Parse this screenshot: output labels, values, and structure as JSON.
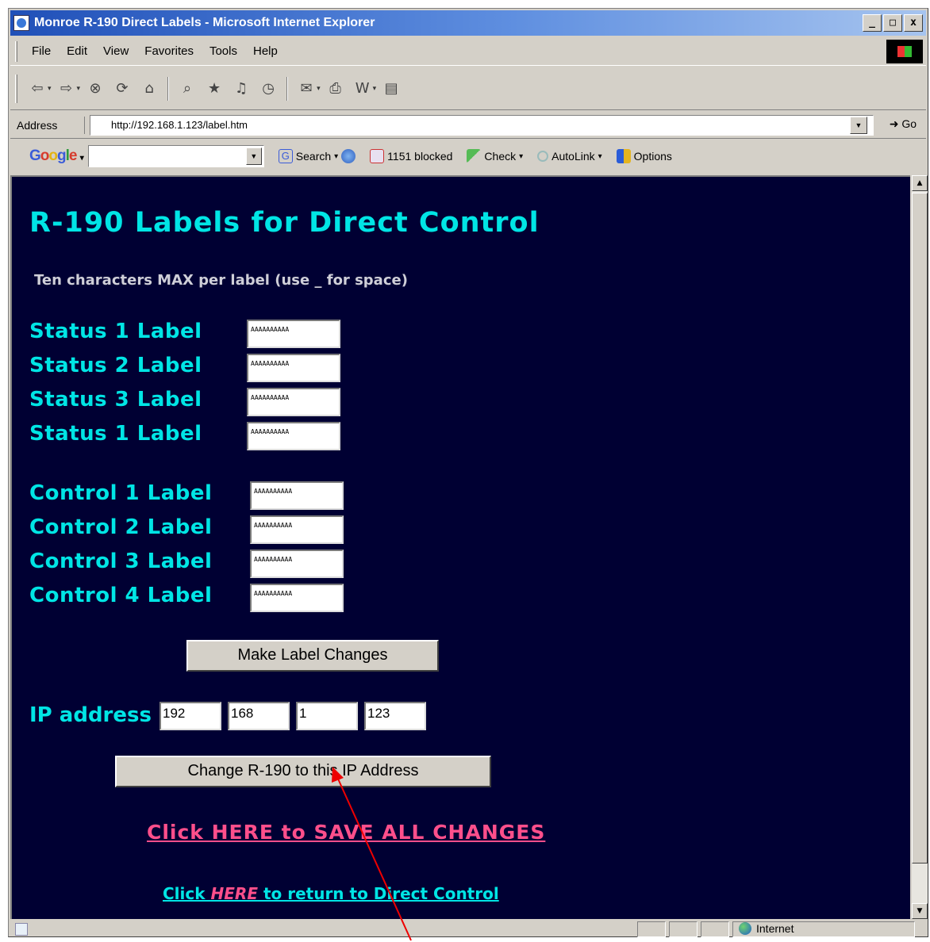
{
  "window": {
    "title": "Monroe R-190 Direct Labels - Microsoft Internet Explorer",
    "minimize": "_",
    "maximize": "□",
    "close": "x"
  },
  "menu": [
    "File",
    "Edit",
    "View",
    "Favorites",
    "Tools",
    "Help"
  ],
  "address": {
    "label": "Address",
    "url": "http://192.168.1.123/label.htm",
    "go": "Go"
  },
  "google_toolbar": {
    "logo": "Google",
    "search_label": "Search",
    "blocked": "1151 blocked",
    "check": "Check",
    "autolink": "AutoLink",
    "options": "Options"
  },
  "page": {
    "title": "R-190 Labels for Direct Control",
    "hint": "Ten characters MAX per label (use _ for space)",
    "status_fields": [
      {
        "label": "Status 1 Label",
        "value": "AAAAAAAAAA"
      },
      {
        "label": "Status 2 Label",
        "value": "AAAAAAAAAA"
      },
      {
        "label": "Status 3 Label",
        "value": "AAAAAAAAAA"
      },
      {
        "label": "Status 1 Label",
        "value": "AAAAAAAAAA"
      }
    ],
    "control_fields": [
      {
        "label": "Control 1 Label",
        "value": "AAAAAAAAAA"
      },
      {
        "label": "Control 2 Label",
        "value": "AAAAAAAAAA"
      },
      {
        "label": "Control 3 Label",
        "value": "AAAAAAAAAA"
      },
      {
        "label": "Control 4 Label",
        "value": "AAAAAAAAAA"
      }
    ],
    "make_changes_button": "Make Label Changes",
    "ip": {
      "label": "IP address",
      "octets": [
        "192",
        "168",
        "1",
        "123"
      ]
    },
    "change_ip_button": "Change R-190 to this IP Address",
    "save_link": "Click HERE to SAVE ALL CHANGES",
    "return_link": {
      "prefix": "Click ",
      "here": "HERE",
      "suffix": " to return to Direct Control"
    }
  },
  "status_bar": {
    "zone": "Internet"
  },
  "colors": {
    "page_background": "#000033",
    "heading": "#00e5e5",
    "link_pink": "#ff4f8b",
    "annotation_arrow": "#ee0000"
  }
}
